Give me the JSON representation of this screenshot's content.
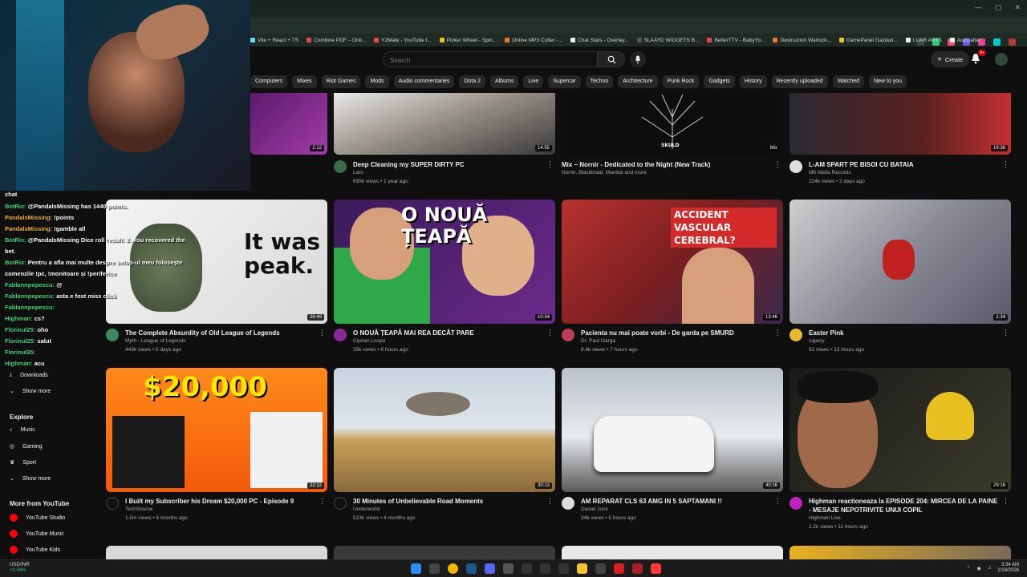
{
  "bookmarks": [
    "Vite + React + TS",
    "Combine PDF – Onli...",
    "Y2Mate - YouTube t...",
    "Picker Wheel - Spin...",
    "Online MP3 Cutter -...",
    "Chat Stats - Overlay...",
    "SLAAYD WIDGETS B...",
    "BetterTTV - BabyYo...",
    "Destruction Warlock...",
    "GamePanel Gazduir...",
    "LUAR ARTS",
    "Audioalter"
  ],
  "header": {
    "search_placeholder": "Search",
    "create_label": "Create",
    "notif_count": "9+"
  },
  "chips": [
    "Computers",
    "Mixes",
    "Riot Games",
    "Mods",
    "Audio commentaries",
    "Dota 2",
    "Albums",
    "Live",
    "Supercar",
    "Techno",
    "Architecture",
    "Punk Rock",
    "Gadgets",
    "History",
    "Recently uploaded",
    "Watched",
    "New to you"
  ],
  "sidebar": {
    "downloads": "Downloads",
    "show_more_1": "Show more",
    "explore": "Explore",
    "music": "Music",
    "gaming": "Gaming",
    "sport": "Sport",
    "show_more_2": "Show more",
    "more_from": "More from YouTube",
    "studio": "YouTube Studio",
    "music_app": "YouTube Music",
    "kids": "YouTube Kids"
  },
  "row0": [
    {
      "duration": "2:12"
    },
    {
      "title": "Deep Cleaning my SUPER DIRTY PC",
      "channel": "Lars",
      "stats": "695k views • 1 year ago",
      "duration": "14:55"
    },
    {
      "title": "Mix – Nornir - Dedicated to the Night (New Track)",
      "channel": "Nornir, Blackbraid, Marduk and more",
      "stats": "",
      "duration": "Mix",
      "thumb_text": "SKULD"
    },
    {
      "title": "L-AM SPART PE BISOI CU BATAIA",
      "channel": "M6 Mafia Records",
      "stats": "224k views • 2 days ago",
      "duration": "19:36"
    }
  ],
  "row1": [
    {
      "title": "The Complete Absurdity of Old League of Legends",
      "channel": "Myth - League of Legends",
      "stats": "443k views • 5 days ago",
      "duration": "26:49",
      "thumb_text": "It was peak."
    },
    {
      "title": "O NOUĂ ȚEAPĂ MAI REA DECÂT PARE",
      "channel": "Ciprian Lospa",
      "stats": "35k views • 8 hours ago",
      "duration": "10:34",
      "thumb_text": "O NOUĂ ȚEAPĂ"
    },
    {
      "title": "Pacienta nu mai poate vorbi - De garda pe SMURD",
      "channel": "Dr. Paul Oarga",
      "stats": "8.4k views • 7 hours ago",
      "duration": "13:46",
      "thumb_text": "ACCIDENT VASCULAR CEREBRAL?"
    },
    {
      "title": "Easter Pink",
      "channel": "capery",
      "stats": "92 views • 13 hours ago",
      "duration": "1:34"
    }
  ],
  "row2": [
    {
      "title": "I Built my Subscriber his Dream $20,000 PC - Episode 9",
      "channel": "TechSource",
      "stats": "1.5m views • 6 months ago",
      "duration": "22:12",
      "thumb_text": "$20,000"
    },
    {
      "title": "30 Minutes of Unbelievable Road Moments",
      "channel": "Underworld",
      "stats": "523k views • 4 months ago",
      "duration": "30:13"
    },
    {
      "title": "AM REPARAT CLS 63 AMG IN 5 SAPTAMANI !!",
      "channel": "Daniel Junc",
      "stats": "34k views • 5 hours ago",
      "duration": "40:16"
    },
    {
      "title": "Highman reactioneaza la EPISODE 204: MIRCEA DE LA PAINE - MESAJE NEPOTRIVITE UNUI COPIL",
      "channel": "Highman Live",
      "stats": "2.2k views • 11 hours ago",
      "duration": "29:16"
    }
  ],
  "chat": [
    {
      "user": "BotRix:",
      "msg": "@PandalsMissing has 1440 points."
    },
    {
      "user": "PandalsMissing:",
      "msg": "!points"
    },
    {
      "user": "PandalsMissing:",
      "msg": "!gamble all"
    },
    {
      "user": "BotRix:",
      "msg": "@PandalsMissing Dice roll result: 2. You recovered the"
    },
    {
      "user": "",
      "msg": "bet."
    },
    {
      "user": "BotRix:",
      "msg": "Pentru a afla mai multe despre setup-ul meu folosește"
    },
    {
      "user": "",
      "msg": "comenzile !pc, !monitoare și !periferice"
    },
    {
      "user": "Fablannpopescu:",
      "msg": "@"
    },
    {
      "user": "Fablannpopescu:",
      "msg": "asta e fost miss click"
    },
    {
      "user": "Fablannpopescu:",
      "msg": ""
    },
    {
      "user": "Highman:",
      "msg": "cs?"
    },
    {
      "user": "Florinul25:",
      "msg": "oho"
    },
    {
      "user": "Florinul25:",
      "msg": "salut"
    },
    {
      "user": "Florinul25:",
      "msg": ""
    },
    {
      "user": "Highman:",
      "msg": "acu"
    }
  ],
  "chat_label": "chat",
  "taskbar": {
    "ticker_name": "USD/INR",
    "ticker_change": "+0.58%",
    "time": "3:34 AM",
    "date": "1/19/2026"
  },
  "colors": {
    "accent_red": "#ff0000",
    "chat_green": "#39d77a",
    "bg": "#0f0f0f"
  }
}
